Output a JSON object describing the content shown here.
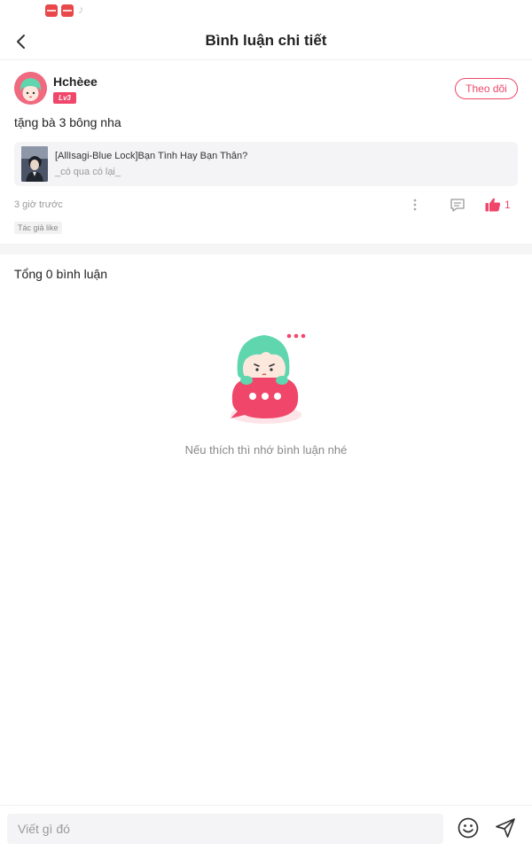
{
  "status_bar": {
    "note_icon": "tiktok-icon"
  },
  "header": {
    "title": "Bình luận chi tiết",
    "back_icon": "back-arrow-icon"
  },
  "post": {
    "username": "Hchèee",
    "level": "Lv3",
    "follow_label": "Theo dõi",
    "text": "tặng bà 3 bông nha",
    "story": {
      "title": "[AllIsagi-Blue Lock]Bạn Tình Hay Bạn Thân?",
      "author": "_có qua có lại_"
    },
    "time": "3 giờ trước",
    "like_count": "1",
    "author_liked": "Tác giả like"
  },
  "comments": {
    "total_label": "Tổng 0 bình luận",
    "empty_text": "Nếu thích thì nhớ bình luận nhé"
  },
  "input_bar": {
    "placeholder": "Viết gì đó"
  },
  "colors": {
    "accent": "#f0466a",
    "mint_hair": "#5fd6ae",
    "divider": "#f5f5f5"
  }
}
